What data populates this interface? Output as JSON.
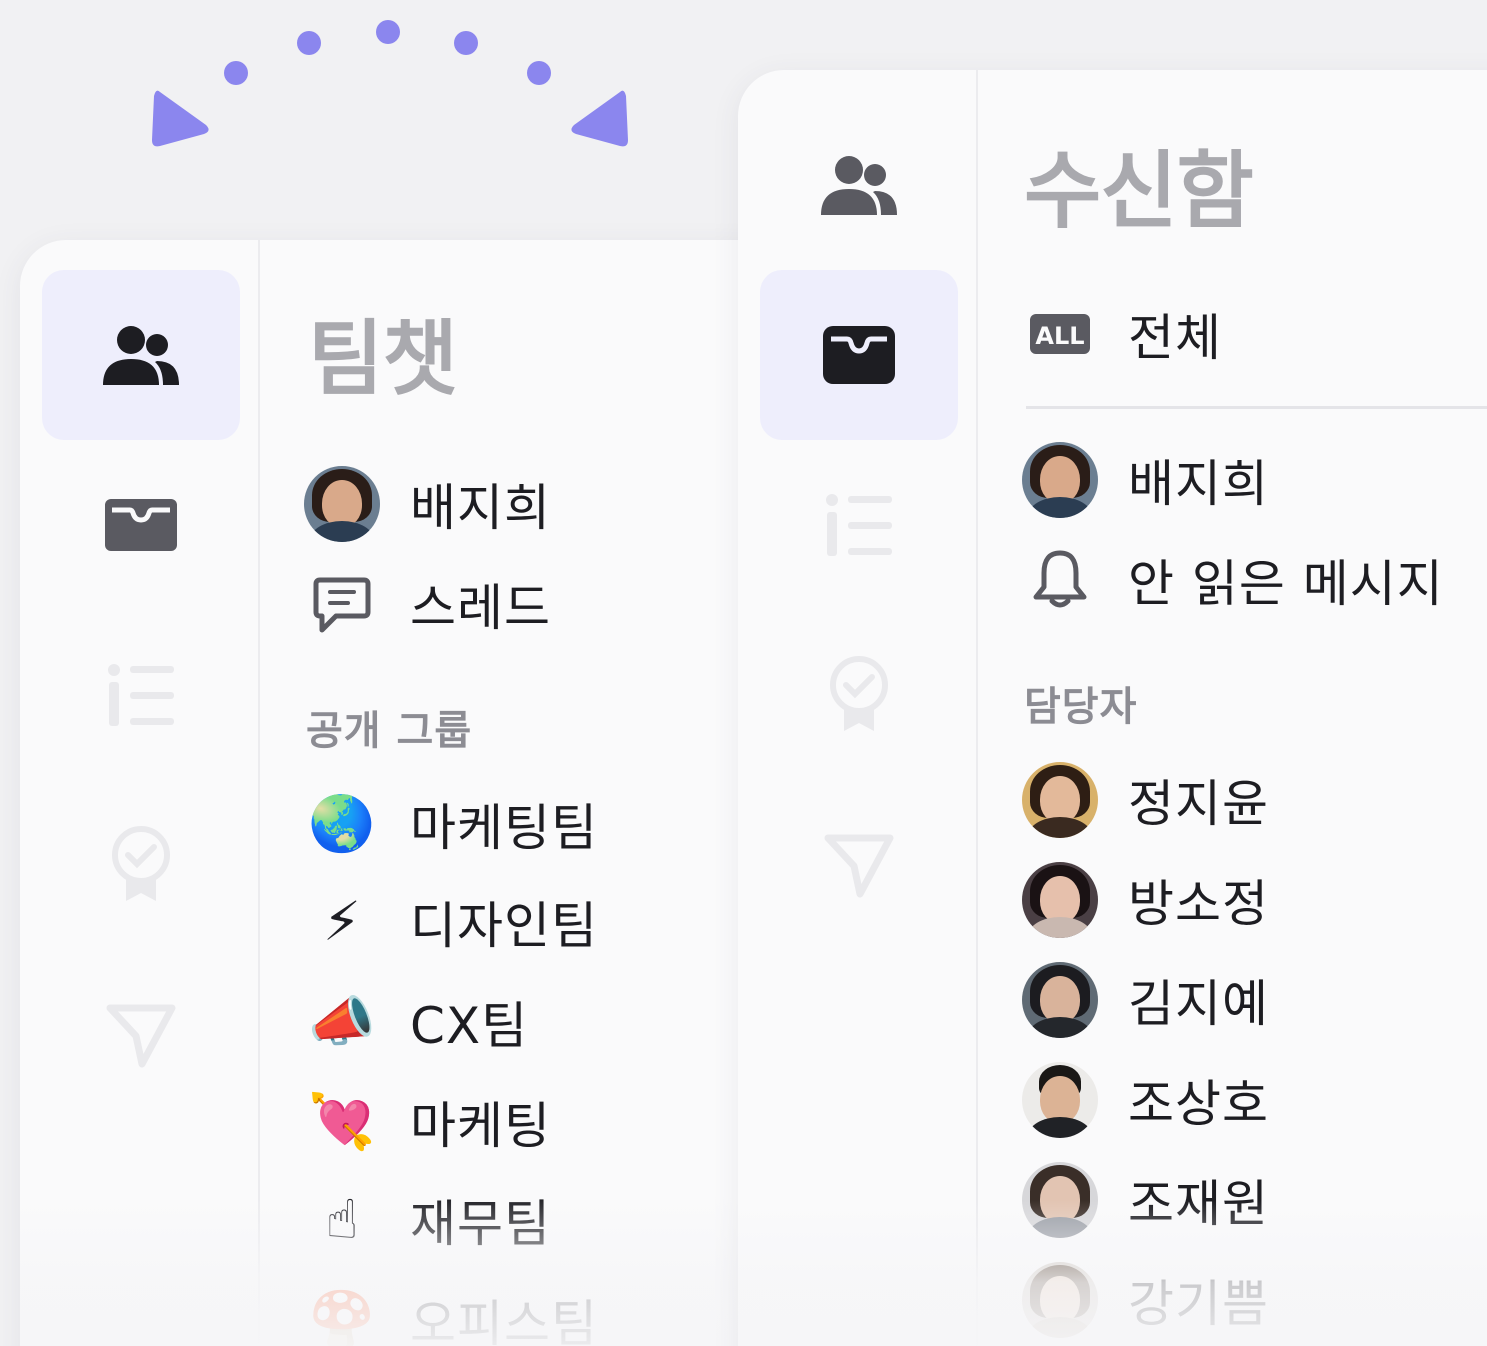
{
  "colors": {
    "accent": "#8b86ee",
    "active_bg": "#eeeefc",
    "title_gray": "#a9a9ae",
    "section_gray": "#8c8c93"
  },
  "left_panel": {
    "rail": [
      {
        "icon": "team-icon",
        "active": true
      },
      {
        "icon": "inbox-icon",
        "active": false
      },
      {
        "icon": "list-icon",
        "active": false
      },
      {
        "icon": "badge-icon",
        "active": false
      },
      {
        "icon": "send-icon",
        "active": false
      }
    ],
    "title": "팀챗",
    "items": [
      {
        "label": "배지희",
        "icon": "avatar"
      },
      {
        "label": "스레드",
        "icon": "thread-icon"
      }
    ],
    "section_label": "공개 그룹",
    "groups": [
      {
        "label": "마케팅팀",
        "icon": "globe-icon",
        "glyph": "🌏"
      },
      {
        "label": "디자인팀",
        "icon": "lightning-icon",
        "glyph": "⚡"
      },
      {
        "label": "CX팀",
        "icon": "megaphone-icon",
        "glyph": "📣"
      },
      {
        "label": "마케팅",
        "icon": "heart-arrow-icon",
        "glyph": "💘"
      },
      {
        "label": "재무팀",
        "icon": "pointing-up-icon",
        "glyph": "☝"
      },
      {
        "label": "오피스팀",
        "icon": "mushroom-icon",
        "glyph": "🍄"
      }
    ]
  },
  "right_panel": {
    "rail": [
      {
        "icon": "team-icon",
        "active": false
      },
      {
        "icon": "inbox-icon",
        "active": true
      },
      {
        "icon": "list-icon",
        "active": false
      },
      {
        "icon": "badge-icon",
        "active": false
      },
      {
        "icon": "send-icon",
        "active": false
      }
    ],
    "title": "수신함",
    "all_label": "전체",
    "all_badge": "ALL",
    "items": [
      {
        "label": "배지희",
        "icon": "avatar"
      },
      {
        "label": "안 읽은 메시지",
        "icon": "bell-icon"
      }
    ],
    "section_label": "담당자",
    "assignees": [
      {
        "label": "정지윤"
      },
      {
        "label": "방소정"
      },
      {
        "label": "김지예"
      },
      {
        "label": "조상호"
      },
      {
        "label": "조재원"
      },
      {
        "label": "강기쁨"
      }
    ]
  }
}
